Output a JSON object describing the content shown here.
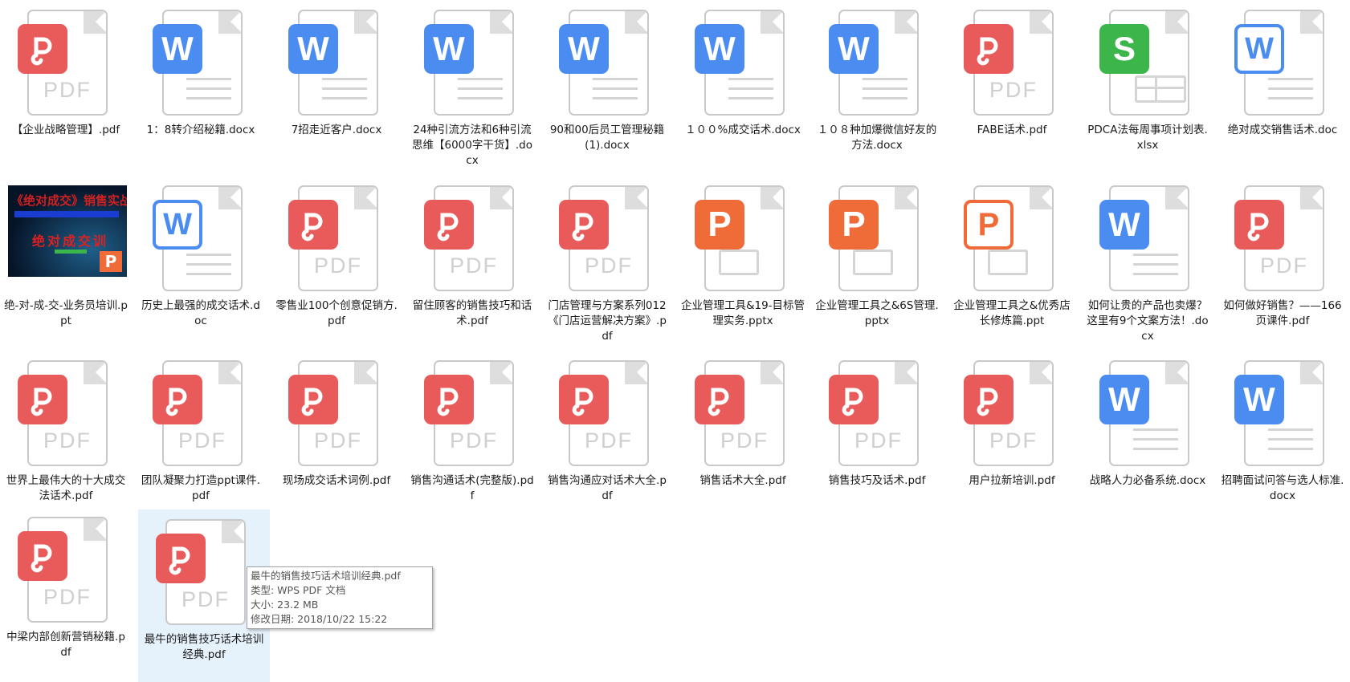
{
  "files": [
    {
      "name": "【企业战略管理】.pdf",
      "type": "pdf"
    },
    {
      "name": "1：8转介绍秘籍.docx",
      "type": "word"
    },
    {
      "name": "7招走近客户.docx",
      "type": "word"
    },
    {
      "name": "24种引流方法和6种引流思维【6000字干货】.docx",
      "type": "word"
    },
    {
      "name": "90和00后员工管理秘籍(1).docx",
      "type": "word"
    },
    {
      "name": "１００%成交话术.docx",
      "type": "word"
    },
    {
      "name": "１０８种加爆微信好友的方法.docx",
      "type": "word"
    },
    {
      "name": "FABE话术.pdf",
      "type": "pdf"
    },
    {
      "name": "PDCA法每周事项计划表.xlsx",
      "type": "xlsx"
    },
    {
      "name": "绝对成交销售话术.doc",
      "type": "word-outline"
    },
    {
      "name": "绝-对-成-交-业务员培训.ppt",
      "type": "thumbnail"
    },
    {
      "name": "历史上最强的成交话术.doc",
      "type": "word-outline"
    },
    {
      "name": "零售业100个创意促销方.pdf",
      "type": "pdf"
    },
    {
      "name": "留住顾客的销售技巧和话术.pdf",
      "type": "pdf"
    },
    {
      "name": "门店管理与方案系列012《门店运营解决方案》.pdf",
      "type": "pdf"
    },
    {
      "name": "企业管理工具&19-目标管理实务.pptx",
      "type": "pptx"
    },
    {
      "name": "企业管理工具之&6S管理.pptx",
      "type": "pptx"
    },
    {
      "name": "企业管理工具之&优秀店长修炼篇.ppt",
      "type": "ppt-outline"
    },
    {
      "name": "如何让贵的产品也卖爆？这里有9个文案方法！.docx",
      "type": "word"
    },
    {
      "name": "如何做好销售？——166页课件.pdf",
      "type": "pdf"
    },
    {
      "name": "世界上最伟大的十大成交法话术.pdf",
      "type": "pdf"
    },
    {
      "name": "团队凝聚力打造ppt课件.pdf",
      "type": "pdf"
    },
    {
      "name": "现场成交话术词例.pdf",
      "type": "pdf"
    },
    {
      "name": "销售沟通话术(完整版).pdf",
      "type": "pdf"
    },
    {
      "name": "销售沟通应对话术大全.pdf",
      "type": "pdf"
    },
    {
      "name": "销售话术大全.pdf",
      "type": "pdf"
    },
    {
      "name": "销售技巧及话术.pdf",
      "type": "pdf"
    },
    {
      "name": "用户拉新培训.pdf",
      "type": "pdf"
    },
    {
      "name": "战略人力必备系统.docx",
      "type": "word"
    },
    {
      "name": "招聘面试问答与选人标准.docx",
      "type": "word"
    },
    {
      "name": "中梁内部创新营销秘籍.pdf",
      "type": "pdf"
    },
    {
      "name": "最牛的销售技巧话术培训经典.pdf",
      "type": "pdf",
      "selected": true
    }
  ],
  "icon_text": {
    "pdf": "PDF",
    "word": "W",
    "xlsx": "S",
    "pptx": "P"
  },
  "thumbnail": {
    "title": "《绝对成交》销售实战训练",
    "subtitle": "绝对成交训"
  },
  "tooltip": {
    "name": "最牛的销售技巧话术培训经典.pdf",
    "type": "类型: WPS PDF 文档",
    "size": "大小: 23.2 MB",
    "modified": "修改日期: 2018/10/22 15:22"
  }
}
